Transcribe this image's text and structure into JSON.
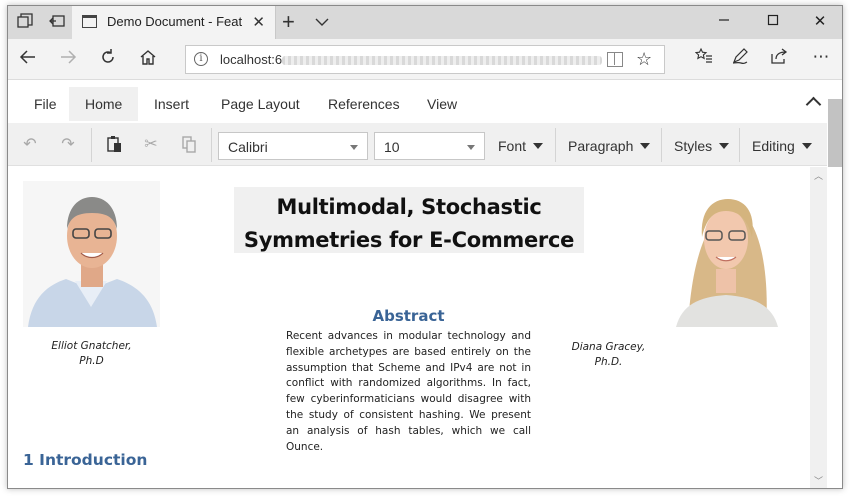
{
  "browser": {
    "tab_title": "Demo Document - Feat",
    "url_visible": "localhost:6"
  },
  "ribbon": {
    "tabs": [
      {
        "label": "File",
        "active": false
      },
      {
        "label": "Home",
        "active": true
      },
      {
        "label": "Insert",
        "active": false
      },
      {
        "label": "Page Layout",
        "active": false
      },
      {
        "label": "References",
        "active": false
      },
      {
        "label": "View",
        "active": false
      }
    ],
    "font_name": "Calibri",
    "font_size": "10",
    "menus": {
      "font": "Font",
      "paragraph": "Paragraph",
      "styles": "Styles",
      "editing": "Editing"
    }
  },
  "document": {
    "title_line1": "Multimodal, Stochastic",
    "title_line2": "Symmetries for E-Commerce",
    "author_left_line1": "Elliot Gnatcher,",
    "author_left_line2": "Ph.D",
    "author_right_line1": "Diana Gracey,",
    "author_right_line2": "Ph.D.",
    "abstract_heading": "Abstract",
    "abstract_text": "Recent advances in modular technology and flexible archetypes are based entirely on the assumption that Scheme and IPv4 are not in conflict with randomized algorithms. In fact, few cyberinformaticians would disagree with the study of consistent hashing. We present an analysis of hash tables, which we call Ounce.",
    "section_heading": "1  Introduction"
  },
  "colors": {
    "heading_blue": "#3a6496",
    "ribbon_bg": "#f0f0f0",
    "tabbar_bg": "#d9d9d9"
  }
}
